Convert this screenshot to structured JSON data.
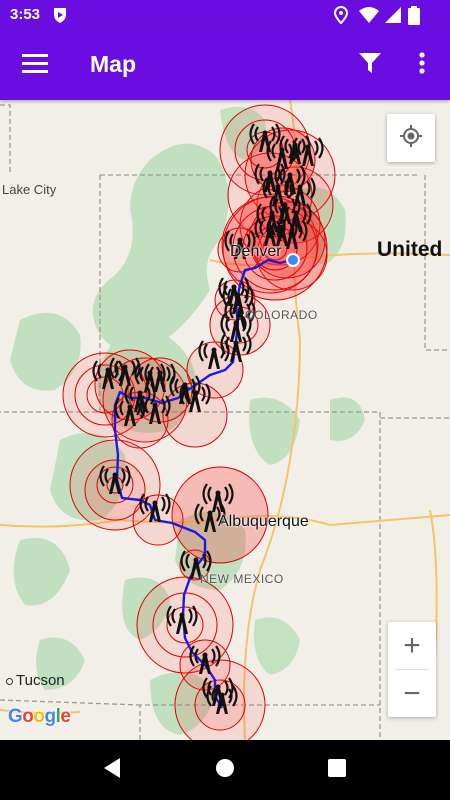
{
  "status_bar": {
    "time": "3:53",
    "icons": [
      "shield-app-icon",
      "location-icon",
      "wifi-icon",
      "signal-icon",
      "battery-icon"
    ]
  },
  "app_bar": {
    "title": "Map",
    "background": "#6A0DE0",
    "icons": [
      "menu-icon",
      "filter-icon",
      "more-vert-icon"
    ]
  },
  "map": {
    "places": {
      "lake_city": "Lake City",
      "denver": "Denver",
      "colorado": "COLORADO",
      "united": "United",
      "albuquerque": "Albuquerque",
      "new_mexico": "NEW MEXICO",
      "tucson": "Tucson"
    },
    "attribution": "Google",
    "zoom_in_label": "+",
    "zoom_out_label": "−",
    "tower_icon": "cell-tower-icon",
    "coverage_color": "#E00000",
    "route_color": "#1A1AE6",
    "current_location_color": "#4285F4"
  },
  "nav_bar": {
    "icons": [
      "back-icon",
      "home-icon",
      "recents-icon"
    ]
  }
}
